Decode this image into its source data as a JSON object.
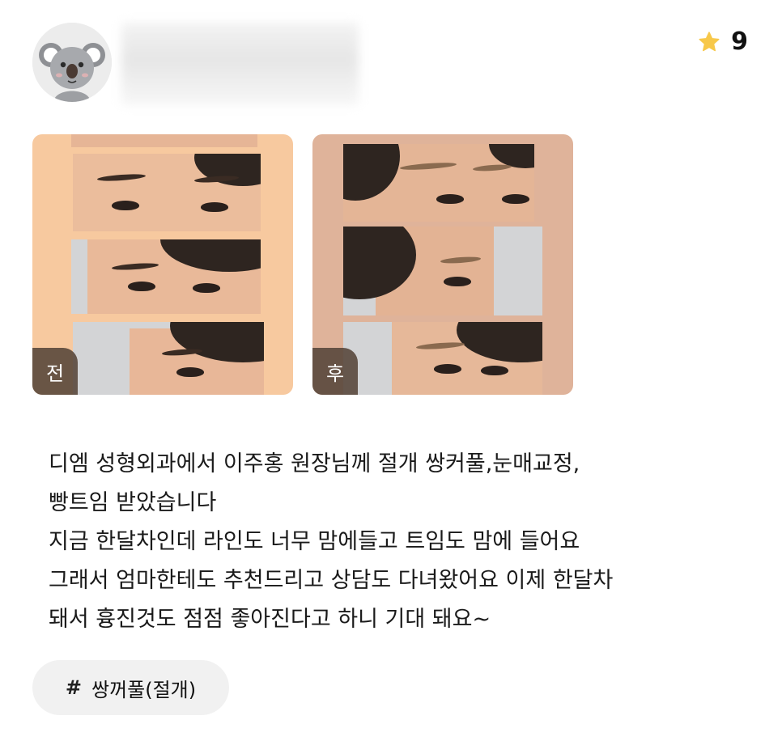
{
  "header": {
    "avatar_icon": "koala-avatar-icon",
    "rating": {
      "icon": "star-icon",
      "value": "9",
      "star_color": "#f7c84a"
    }
  },
  "photos": [
    {
      "badge": "전"
    },
    {
      "badge": "후"
    }
  ],
  "review": {
    "lines": [
      "디엠 성형외과에서 이주홍 원장님께 절개 쌍커풀,눈매교정,",
      "빵트임 받았습니다",
      "지금 한달차인데 라인도 너무 맘에들고 트임도 맘에 들어요",
      "그래서 엄마한테도 추천드리고 상담도 다녀왔어요 이제 한달차",
      "돼서 흉진것도 점점 좋아진다고 하니 기대 돼요~"
    ]
  },
  "tags": [
    {
      "icon": "hash-icon",
      "symbol": "#",
      "label": "쌍꺼풀(절개)"
    }
  ]
}
